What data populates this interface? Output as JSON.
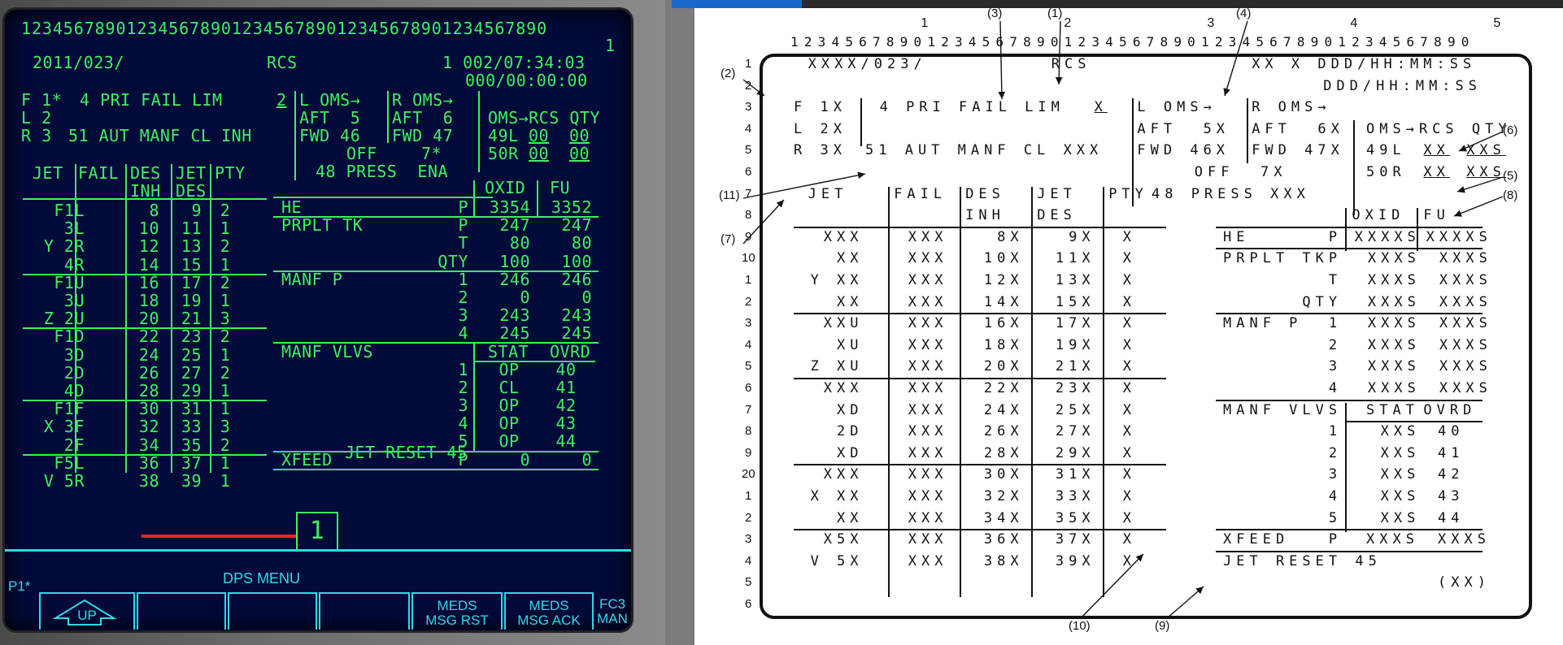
{
  "crt": {
    "ruler_top": "12345678901234567890123456789012345678901234567890",
    "ruler_one": "1",
    "date": "2011/023/",
    "title": "RCS",
    "timer1": "1 002/07:34:03",
    "timer2": "000/00:00:00",
    "f_row": "F 1*",
    "l_row": "L 2",
    "r_row": "R 3",
    "pri_fail": "4 PRI FAIL LIM",
    "pri_val": "2",
    "aut_manf": "51 AUT MANF CL INH",
    "l_oms": "L OMS→",
    "l_aft": "AFT  5",
    "l_fwd": "FWD 46",
    "l_off": "OFF",
    "r_oms": "R OMS→",
    "r_aft": "AFT  6",
    "r_fwd": "FWD 47",
    "r_off": "7*",
    "oms_qty": "OMS→RCS QTY",
    "qty_49": "49L",
    "qty_50": "50R",
    "qty_val": "00",
    "press": "48 PRESS  ENA",
    "jet_head": [
      "JET",
      "FAIL",
      "DES",
      "JET",
      "PTY"
    ],
    "jet_head2": [
      "INH",
      "DES"
    ],
    "jets": [
      {
        "jet": "F1L",
        "inh": "8",
        "des": "9",
        "pty": "2"
      },
      {
        "jet": "3L",
        "inh": "10",
        "des": "11",
        "pty": "1"
      },
      {
        "jet": "Y 2R",
        "inh": "12",
        "des": "13",
        "pty": "2"
      },
      {
        "jet": "4R",
        "inh": "14",
        "des": "15",
        "pty": "1"
      },
      {
        "jet": "F1U",
        "inh": "16",
        "des": "17",
        "pty": "2"
      },
      {
        "jet": "3U",
        "inh": "18",
        "des": "19",
        "pty": "1"
      },
      {
        "jet": "Z 2U",
        "inh": "20",
        "des": "21",
        "pty": "3"
      },
      {
        "jet": "F1D",
        "inh": "22",
        "des": "23",
        "pty": "2"
      },
      {
        "jet": "3D",
        "inh": "24",
        "des": "25",
        "pty": "1"
      },
      {
        "jet": "2D",
        "inh": "26",
        "des": "27",
        "pty": "2"
      },
      {
        "jet": "4D",
        "inh": "28",
        "des": "29",
        "pty": "1"
      },
      {
        "jet": "F1F",
        "inh": "30",
        "des": "31",
        "pty": "1"
      },
      {
        "jet": "X 3F",
        "inh": "32",
        "des": "33",
        "pty": "3"
      },
      {
        "jet": "2F",
        "inh": "34",
        "des": "35",
        "pty": "2"
      },
      {
        "jet": "F5L",
        "inh": "36",
        "des": "37",
        "pty": "1"
      },
      {
        "jet": "V 5R",
        "inh": "38",
        "des": "39",
        "pty": "1"
      }
    ],
    "oxid": "OXID",
    "fu": "FU",
    "rows_right": [
      {
        "label": "HE",
        "sub": "P",
        "ox": "3354",
        "fu": "3352"
      },
      {
        "label": "PRPLT TK",
        "sub": "P",
        "ox": "247",
        "fu": "247"
      },
      {
        "label": "",
        "sub": "T",
        "ox": "80",
        "fu": "80"
      },
      {
        "label": "",
        "sub": "QTY",
        "ox": "100",
        "fu": "100"
      },
      {
        "label": "MANF P",
        "sub": "1",
        "ox": "246",
        "fu": "246"
      },
      {
        "label": "",
        "sub": "2",
        "ox": "0",
        "fu": "0"
      },
      {
        "label": "",
        "sub": "3",
        "ox": "243",
        "fu": "243"
      },
      {
        "label": "",
        "sub": "4",
        "ox": "245",
        "fu": "245"
      }
    ],
    "manf_vlvs": "MANF VLVS",
    "stat": "STAT",
    "ovrd": "OVRD",
    "vlvs": [
      {
        "n": "1",
        "stat": "OP",
        "ovrd": "40"
      },
      {
        "n": "2",
        "stat": "CL",
        "ovrd": "41"
      },
      {
        "n": "3",
        "stat": "OP",
        "ovrd": "42"
      },
      {
        "n": "4",
        "stat": "OP",
        "ovrd": "43"
      },
      {
        "n": "5",
        "stat": "OP",
        "ovrd": "44"
      }
    ],
    "xfeed": "XFEED",
    "xfeed_p": "P",
    "xfeed_ox": "0",
    "xfeed_fu": "0",
    "jet_reset": "JET RESET 45",
    "page_box": "1",
    "dps_menu": "DPS MENU",
    "p1": "P1*",
    "up": "UP",
    "meds_rst": [
      "MEDS",
      "MSG RST"
    ],
    "meds_ack": [
      "MEDS",
      "MSG ACK"
    ],
    "fc3": [
      "FC3",
      "MAN"
    ]
  },
  "diagram": {
    "ruler_tens": [
      "1",
      "2",
      "3",
      "4",
      "5"
    ],
    "ruler_digits": "12345678901234567890123456789012345678901234567890",
    "row_nums": [
      "1",
      "2",
      "3",
      "4",
      "5",
      "6",
      "7",
      "8",
      "9",
      "10",
      "1",
      "2",
      "3",
      "4",
      "5",
      "6",
      "7",
      "8",
      "9",
      "20",
      "1",
      "2",
      "3",
      "4",
      "5",
      "6"
    ],
    "header_left": "XXXX/023/",
    "header_title": "RCS",
    "header_time1": "XX X DDD/HH:MM:SS",
    "header_time2": "DDD/HH:MM:SS",
    "f": "F 1X",
    "l": "L 2X",
    "r": "R 3X",
    "pri": "4 PRI FAIL LIM",
    "pri_x": "X",
    "aut": "51 AUT MANF CL XXX",
    "l_oms": "L OMS→",
    "l_aft": "AFT  5X",
    "l_fwd": "FWD 46X",
    "l_off": "OFF  7X",
    "r_oms": "R OMS→",
    "r_aft": "AFT  6X",
    "r_fwd": "FWD 47X",
    "oms_qty": "OMS→RCS QTY",
    "q49": "49L",
    "q50": "50R",
    "qxx": "XX",
    "qxxs": "XXS",
    "press": "48 PRESS XXX",
    "jet_head": [
      "JET",
      "FAIL",
      "DES",
      "JET",
      "PTY"
    ],
    "jet_head2": [
      "INH",
      "DES"
    ],
    "jets": [
      {
        "jet": "XXX",
        "inh": "8X",
        "des": "9X"
      },
      {
        "jet": "XX",
        "inh": "10X",
        "des": "11X"
      },
      {
        "jet": "Y XX",
        "inh": "12X",
        "des": "13X"
      },
      {
        "jet": "XX",
        "inh": "14X",
        "des": "15X"
      },
      {
        "jet": "XXU",
        "inh": "16X",
        "des": "17X"
      },
      {
        "jet": "XU",
        "inh": "18X",
        "des": "19X"
      },
      {
        "jet": "Z XU",
        "inh": "20X",
        "des": "21X"
      },
      {
        "jet": "XXX",
        "inh": "22X",
        "des": "23X"
      },
      {
        "jet": "XD",
        "inh": "24X",
        "des": "25X"
      },
      {
        "jet": "2D",
        "inh": "26X",
        "des": "27X"
      },
      {
        "jet": "XD",
        "inh": "28X",
        "des": "29X"
      },
      {
        "jet": "XXX",
        "inh": "30X",
        "des": "31X"
      },
      {
        "jet": "X XX",
        "inh": "32X",
        "des": "33X"
      },
      {
        "jet": "XX",
        "inh": "34X",
        "des": "35X"
      },
      {
        "jet": "X5X",
        "inh": "36X",
        "des": "37X"
      },
      {
        "jet": "V 5X",
        "inh": "38X",
        "des": "39X"
      }
    ],
    "fail": "XXX",
    "pty": "X",
    "oxid": "OXID",
    "fu": "FU",
    "rows_right": [
      {
        "label": "HE",
        "sub": "P",
        "ox": "XXXXS",
        "fu": "XXXXS"
      },
      {
        "label": "PRPLT TK",
        "sub": "P",
        "ox": "XXXS",
        "fu": "XXXS"
      },
      {
        "label": "",
        "sub": "T",
        "ox": "XXXS",
        "fu": "XXXS"
      },
      {
        "label": "",
        "sub": "QTY",
        "ox": "XXXS",
        "fu": "XXXS"
      },
      {
        "label": "MANF P",
        "sub": "1",
        "ox": "XXXS",
        "fu": "XXXS"
      },
      {
        "label": "",
        "sub": "2",
        "ox": "XXXS",
        "fu": "XXXS"
      },
      {
        "label": "",
        "sub": "3",
        "ox": "XXXS",
        "fu": "XXXS"
      },
      {
        "label": "",
        "sub": "4",
        "ox": "XXXS",
        "fu": "XXXS"
      }
    ],
    "manf_vlvs": "MANF VLVS",
    "stat": "STAT",
    "ovrd": "OVRD",
    "vlvs": [
      {
        "n": "1",
        "stat": "XXS",
        "ovrd": "40"
      },
      {
        "n": "2",
        "stat": "XXS",
        "ovrd": "41"
      },
      {
        "n": "3",
        "stat": "XXS",
        "ovrd": "42"
      },
      {
        "n": "4",
        "stat": "XXS",
        "ovrd": "43"
      },
      {
        "n": "5",
        "stat": "XXS",
        "ovrd": "44"
      }
    ],
    "xfeed": "XFEED",
    "xfeed_p": "P",
    "xfeed_ox": "XXXS",
    "xfeed_fu": "XXXS",
    "jet_reset": "JET RESET 45",
    "xx_paren": "(XX)",
    "callouts": [
      "(1)",
      "(2)",
      "(3)",
      "(4)",
      "(5)",
      "(6)",
      "(7)",
      "(8)",
      "(9)",
      "(10)",
      "(11)"
    ]
  }
}
